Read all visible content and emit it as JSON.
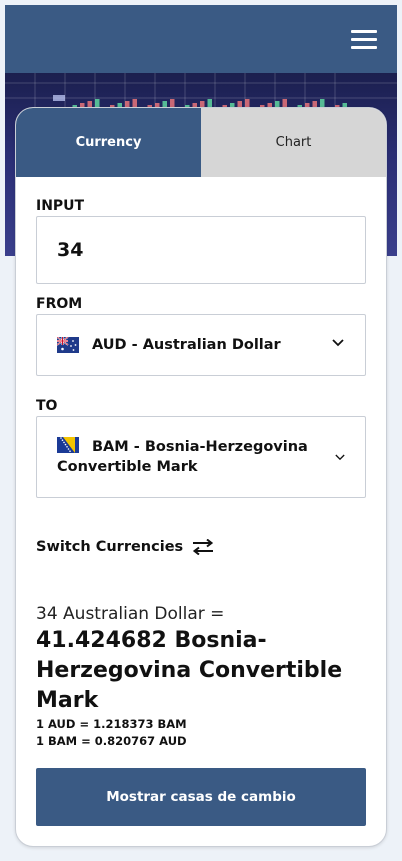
{
  "header": {
    "menu_icon": "hamburger-menu-icon"
  },
  "tabs": [
    {
      "label": "Currency",
      "active": true
    },
    {
      "label": "Chart",
      "active": false
    }
  ],
  "input": {
    "label": "INPUT",
    "value": "34"
  },
  "from": {
    "label": "FROM",
    "flag_icon": "australia-flag-icon",
    "text": "AUD - Australian Dollar"
  },
  "to": {
    "label": "TO",
    "flag_icon": "bosnia-flag-icon",
    "line1": "BAM - Bosnia-Herzegovina",
    "line2": "Convertible Mark"
  },
  "switch": {
    "label": "Switch Currencies",
    "icon": "swap-arrows-icon"
  },
  "result": {
    "source": "34 Australian Dollar =",
    "amount": "41.424682 Bosnia-Herzegovina Convertible Mark",
    "rate_forward": "1 AUD = 1.218373 BAM",
    "rate_reverse": "1 BAM = 0.820767 AUD"
  },
  "cta": {
    "label": "Mostrar casas de cambio"
  },
  "colors": {
    "primary": "#3a5a84",
    "tab_inactive": "#d6d6d6",
    "background": "#edf2f8"
  }
}
